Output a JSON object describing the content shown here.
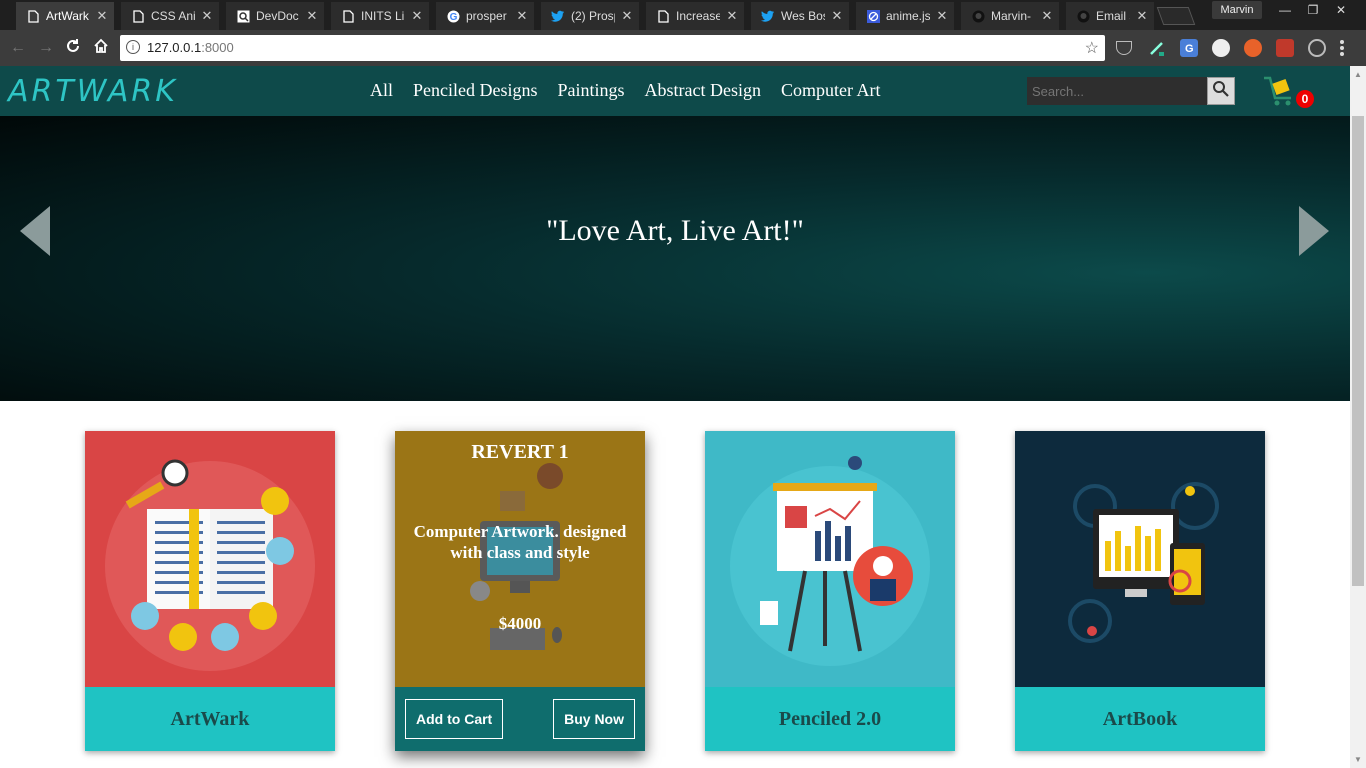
{
  "browser": {
    "tabs": [
      {
        "label": "ArtWark",
        "icon": "page-icon",
        "active": true
      },
      {
        "label": "CSS Ani",
        "icon": "page-icon"
      },
      {
        "label": "DevDoc",
        "icon": "devdocs-icon"
      },
      {
        "label": "INITS Li",
        "icon": "page-icon"
      },
      {
        "label": "prosper",
        "icon": "google-icon"
      },
      {
        "label": "(2) Prosp",
        "icon": "twitter-icon"
      },
      {
        "label": "Increase",
        "icon": "page-icon"
      },
      {
        "label": "Wes Bos",
        "icon": "twitter-icon"
      },
      {
        "label": "anime.js",
        "icon": "anime-icon"
      },
      {
        "label": "Marvin-",
        "icon": "github-icon"
      },
      {
        "label": "Email se",
        "icon": "github-icon"
      }
    ],
    "profile_name": "Marvin",
    "url_host": "127.0.0.1",
    "url_port": ":8000"
  },
  "site": {
    "logo": "ARTWARK",
    "nav": [
      "All",
      "Penciled Designs",
      "Paintings",
      "Abstract Design",
      "Computer Art"
    ],
    "search_placeholder": "Search...",
    "cart_count": "0"
  },
  "hero": {
    "slogan": "\"Love Art, Live Art!\""
  },
  "products": [
    {
      "name": "ArtWark"
    },
    {
      "title": "REVERT 1",
      "description": "Computer Artwork. designed with class and style",
      "price": "$4000",
      "add_to_cart": "Add to Cart",
      "buy_now": "Buy Now"
    },
    {
      "name": "Penciled 2.0"
    },
    {
      "name": "ArtBook"
    }
  ],
  "colors": {
    "navbar": "#0e4a4a",
    "accent": "#1fc3c3",
    "card_footer_hover": "#0f6d6d",
    "badge": "#ee0000"
  }
}
